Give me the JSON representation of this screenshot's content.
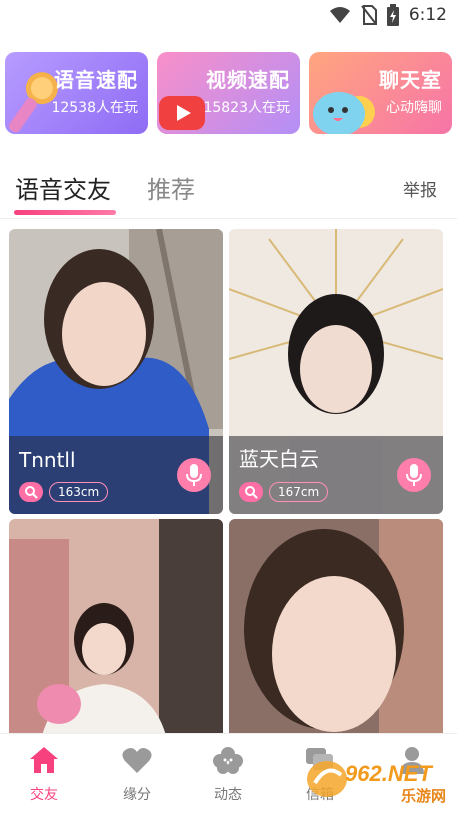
{
  "status_bar": {
    "time": "6:12",
    "icons": [
      "wifi-icon",
      "no-sim-icon",
      "battery-icon"
    ]
  },
  "feature_cards": [
    {
      "title": "语音速配",
      "subtitle": "12538人在玩",
      "icon": "microphone-icon"
    },
    {
      "title": "视频速配",
      "subtitle": "15823人在玩",
      "icon": "play-icon"
    },
    {
      "title": "聊天室",
      "subtitle": "心动嗨聊",
      "icon": "smile-bubble-icon"
    }
  ],
  "tabs": {
    "active": "语音交友",
    "inactive": "推荐",
    "report": "举报"
  },
  "profiles": [
    {
      "name": "Tnntll",
      "height": "163cm",
      "gender_icon": "female-icon",
      "mic_icon": "microphone-icon"
    },
    {
      "name": "蓝天白云",
      "height": "167cm",
      "gender_icon": "female-icon",
      "mic_icon": "microphone-icon"
    }
  ],
  "nav": [
    {
      "label": "交友",
      "icon": "home-icon",
      "active": true
    },
    {
      "label": "缘分",
      "icon": "heart-icon",
      "active": false
    },
    {
      "label": "动态",
      "icon": "flower-icon",
      "active": false
    },
    {
      "label": "信箱",
      "icon": "chat-icon",
      "active": false
    },
    {
      "label": "",
      "icon": "person-icon",
      "active": false
    }
  ],
  "watermark": {
    "text": "962.NET",
    "subtext": "乐游网"
  },
  "colors": {
    "accent": "#f7417f",
    "mic": "#ff7eab"
  }
}
